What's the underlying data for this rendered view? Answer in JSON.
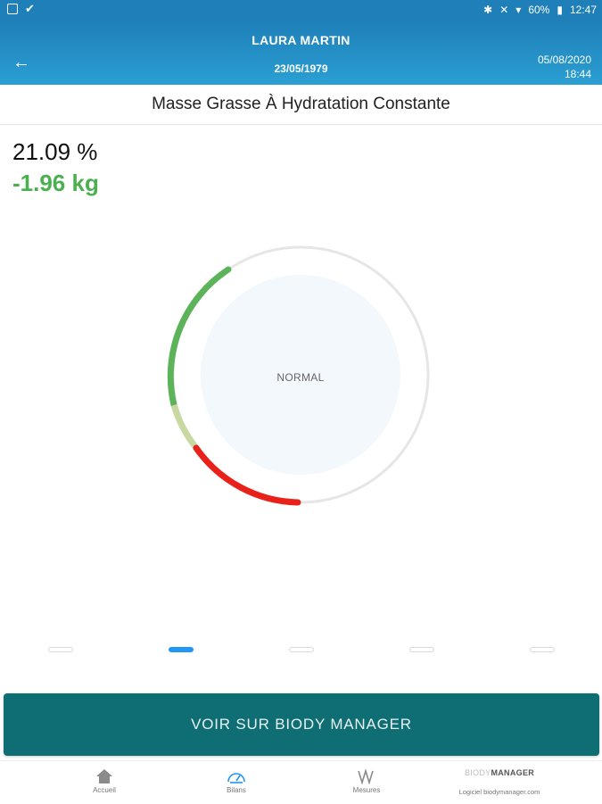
{
  "status_bar": {
    "battery": "60%",
    "time": "12:47"
  },
  "header": {
    "patient_name": "LAURA MARTIN",
    "birth_date": "23/05/1979",
    "date": "05/08/2020",
    "time": "18:44"
  },
  "page": {
    "title": "Masse Grasse À Hydratation Constante"
  },
  "measurement": {
    "value": "21.09 %",
    "delta": "-1.96 kg",
    "status": "NORMAL"
  },
  "gauge": {
    "segments": [
      {
        "name": "green",
        "color": "#5cb35a"
      },
      {
        "name": "light-green",
        "color": "#c7d9a0"
      },
      {
        "name": "red",
        "color": "#e8221b"
      }
    ],
    "track_color": "#e6e6e6",
    "inner_color": "#f3f8fc"
  },
  "pager": {
    "count": 5,
    "active_index": 1
  },
  "cta": {
    "label": "VOIR SUR BIODY MANAGER"
  },
  "bottom_nav": {
    "items": [
      {
        "label": "Accueil",
        "icon": "home-icon"
      },
      {
        "label": "Bilans",
        "icon": "gauge-icon"
      },
      {
        "label": "Mesures",
        "icon": "wave-icon"
      }
    ],
    "brand": {
      "logo_part1": "BIODY",
      "logo_part2": "MANAGER",
      "subtitle": "Logiciel biodymanager.com"
    }
  },
  "colors": {
    "header": "#1f7fb8",
    "accent_blue": "#2196f3",
    "delta_green": "#4caf50",
    "cta_teal": "#0e6e73"
  }
}
